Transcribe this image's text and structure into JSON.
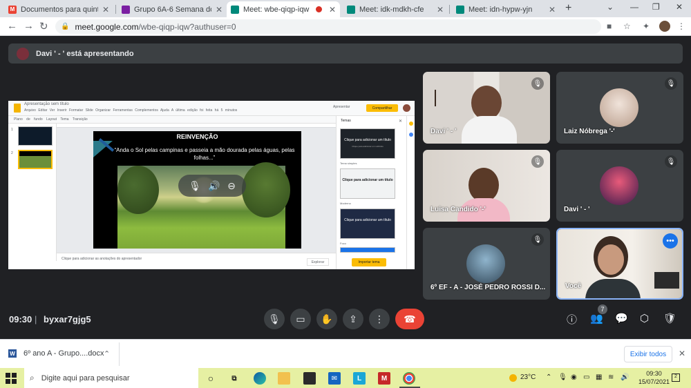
{
  "browser": {
    "tabs": [
      {
        "title": "Documentos para quinta-feira",
        "color": "#ea4335"
      },
      {
        "title": "Grupo 6A-6 Semana do Carnaval",
        "color": "#7b1fa2"
      },
      {
        "title": "Meet: wbe-qiqp-iqw",
        "color": "#00897b"
      },
      {
        "title": "Meet: idk-mdkh-cfe",
        "color": "#00897b"
      },
      {
        "title": "Meet: idn-hypw-yjn",
        "color": "#00897b"
      }
    ],
    "new_tab": "+",
    "url_host": "meet.google.com",
    "url_path": "/wbe-qiqp-iqw?authuser=0"
  },
  "presenting_banner": "Davi ' - ' está apresentando",
  "presentation": {
    "doc_title": "Apresentação sem título",
    "menu": "Arquivo Editar Ver Inserir Formatar Slide Organizar Ferramentas Complementos Ajuda A última edição foi feita há 5 minutos",
    "apresentar": "Apresentar",
    "share": "Compartilhar",
    "toolbar": "Plano de fundo Layout Tema Transição",
    "slide_title": "REINVENÇÃO",
    "slide_quote": "“Anda o Sol pelas campinas e passeia a mão dourada pelas águas, pelas folhas...”",
    "notes_placeholder": "Clique para adicionar as anotações do apresentador",
    "explore": "Explorar",
    "themes_header": "Temas",
    "theme_cards": [
      {
        "text": "Clique para adicionar um título",
        "sub": "Clique para adicionar um subtítulo",
        "label": "Tema simples"
      },
      {
        "text": "Clique para adicionar um título",
        "sub": "",
        "label": "Moderno"
      },
      {
        "text": "Clique para adicionar um título",
        "sub": "",
        "label": "Foco"
      }
    ],
    "import_theme": "Importar tema",
    "thumb_nums": [
      "1",
      "2"
    ]
  },
  "participants": [
    {
      "name": "Davi ' - '"
    },
    {
      "name": "Laiz Nóbrega '-'"
    },
    {
      "name": "Luisa Candido '-'"
    },
    {
      "name": "Davi ' - '"
    },
    {
      "name": "6º EF - A - JOSÉ PEDRO ROSSI D..."
    },
    {
      "name": "Você"
    }
  ],
  "controls": {
    "time": "09:30",
    "separator": "|",
    "meeting_code": "byxar7gjg5",
    "people_count": "7"
  },
  "download": {
    "file": "6º ano A - Grupo....docx",
    "show_all": "Exibir todos"
  },
  "taskbar": {
    "search_placeholder": "Digite aqui para pesquisar",
    "temperature": "23°C",
    "time": "09:30",
    "date": "15/07/2021"
  }
}
